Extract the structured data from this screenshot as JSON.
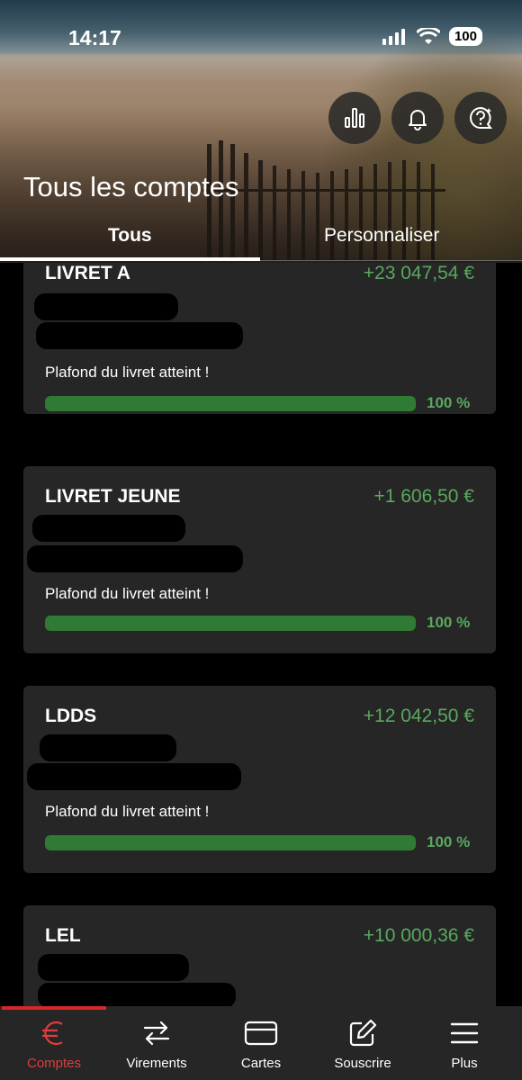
{
  "status_bar": {
    "time": "14:17",
    "battery": "100"
  },
  "header": {
    "title": "Tous les comptes",
    "tabs": [
      {
        "label": "Tous",
        "active": true
      },
      {
        "label": "Personnaliser",
        "active": false
      }
    ],
    "actions": [
      "bar-chart-icon",
      "bell-icon",
      "help-chat-icon"
    ]
  },
  "accounts": [
    {
      "name": "LIVRET A",
      "amount": "+23 047,54 €",
      "note": "Plafond du livret atteint !",
      "progress_label": "100 %",
      "progress": 1.0
    },
    {
      "name": "LIVRET JEUNE",
      "amount": "+1 606,50 €",
      "note": "Plafond du livret atteint !",
      "progress_label": "100 %",
      "progress": 1.0
    },
    {
      "name": "LDDS",
      "amount": "+12 042,50 €",
      "note": "Plafond du livret atteint !",
      "progress_label": "100 %",
      "progress": 1.0
    },
    {
      "name": "LEL",
      "amount": "+10 000,36 €"
    }
  ],
  "bottom_nav": [
    {
      "label": "Comptes",
      "icon": "euro-icon",
      "active": true
    },
    {
      "label": "Virements",
      "icon": "transfer-arrows-icon",
      "active": false
    },
    {
      "label": "Cartes",
      "icon": "card-icon",
      "active": false
    },
    {
      "label": "Souscrire",
      "icon": "edit-icon",
      "active": false
    },
    {
      "label": "Plus",
      "icon": "menu-icon",
      "active": false
    }
  ],
  "colors": {
    "positive": "#5aa85e",
    "progress": "#2f7a35",
    "accent": "#e23b3b",
    "card_bg": "#262626"
  }
}
